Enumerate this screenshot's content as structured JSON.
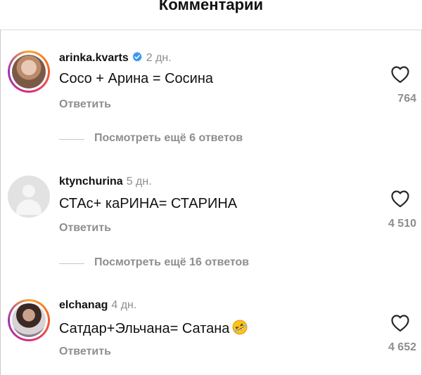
{
  "header": {
    "title": "Комментарии"
  },
  "comments": [
    {
      "username": "arinka.kvarts",
      "verified": true,
      "time": "2 дн.",
      "text": "Coco + Арина = Сосина",
      "reply_label": "Ответить",
      "likes": "764",
      "more_replies": "Посмотреть ещё 6 ответов",
      "avatar_icon": "profile-photo"
    },
    {
      "username": "ktynchurina",
      "verified": false,
      "time": "5 дн.",
      "text": "СТАс+ каРИНА= СТАРИНА",
      "reply_label": "Ответить",
      "likes": "4 510",
      "more_replies": "Посмотреть ещё 16 ответов",
      "avatar_icon": "default-avatar"
    },
    {
      "username": "elchanag",
      "verified": false,
      "time": "4 дн.",
      "text": "Сатдар+Эльчана= Сатана",
      "emoji": "rolling-on-floor-laughing-emoji",
      "reply_label": "Ответить",
      "likes": "4 652",
      "avatar_icon": "profile-photo"
    }
  ],
  "icons": {
    "like": "heart-outline-icon",
    "verified": "verified-badge-icon"
  },
  "colors": {
    "verified_blue": "#3897f0",
    "muted_text": "#8e8e8e",
    "story_ring": [
      "#f9a52a",
      "#f25c2f",
      "#d92e7f",
      "#9b32b8"
    ]
  }
}
